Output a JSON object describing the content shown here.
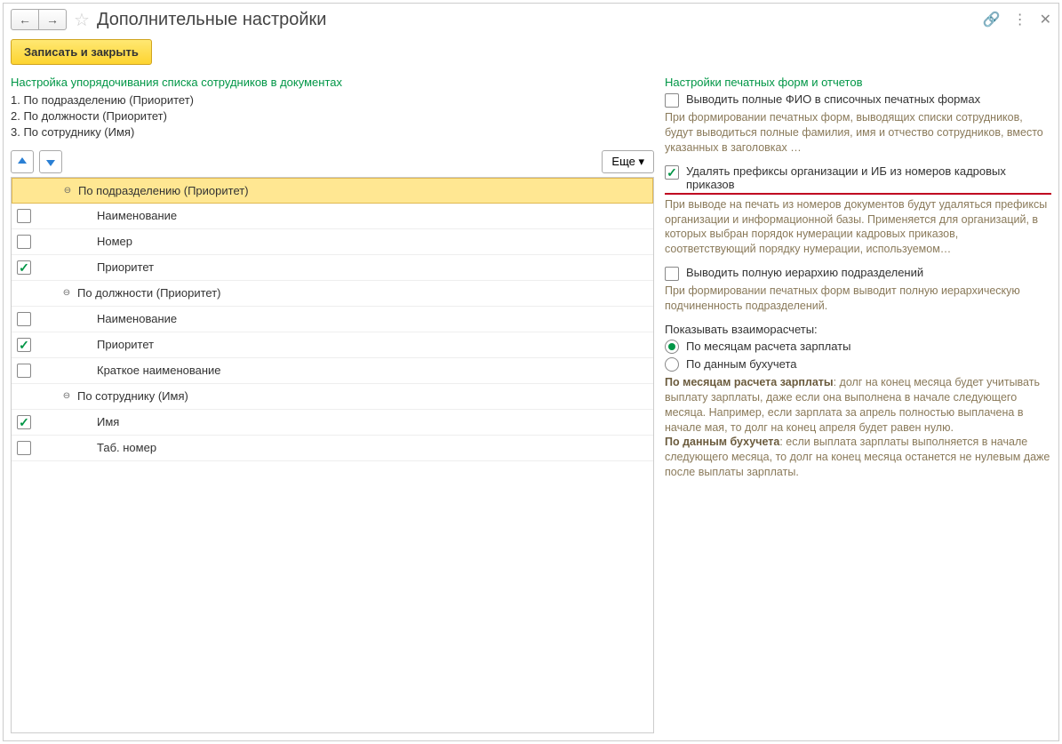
{
  "titlebar": {
    "title": "Дополнительные настройки"
  },
  "toolbar": {
    "save_label": "Записать и закрыть"
  },
  "left": {
    "header": "Настройка упорядочивания списка сотрудников в документах",
    "order": [
      "1. По подразделению (Приоритет)",
      "2. По должности (Приоритет)",
      "3. По сотруднику (Имя)"
    ],
    "more_label": "Еще",
    "tree": [
      {
        "type": "group",
        "label": "По подразделению (Приоритет)",
        "selected": true
      },
      {
        "type": "item",
        "label": "Наименование",
        "checked": false
      },
      {
        "type": "item",
        "label": "Номер",
        "checked": false
      },
      {
        "type": "item",
        "label": "Приоритет",
        "checked": true
      },
      {
        "type": "group",
        "label": "По должности (Приоритет)",
        "selected": false
      },
      {
        "type": "item",
        "label": "Наименование",
        "checked": false
      },
      {
        "type": "item",
        "label": "Приоритет",
        "checked": true
      },
      {
        "type": "item",
        "label": "Краткое наименование",
        "checked": false
      },
      {
        "type": "group",
        "label": "По сотруднику (Имя)",
        "selected": false
      },
      {
        "type": "item",
        "label": "Имя",
        "checked": true
      },
      {
        "type": "item",
        "label": "Таб. номер",
        "checked": false
      }
    ]
  },
  "right": {
    "header": "Настройки печатных форм и отчетов",
    "check1_label": "Выводить полные ФИО в списочных печатных формах",
    "check1_help": "При формировании печатных форм, выводящих списки сотрудников, будут выводиться полные фамилия, имя и отчество сотрудников, вместо указанных в заголовках …",
    "check2_label": "Удалять префиксы организации и ИБ из номеров кадровых приказов",
    "check2_help": "При выводе на печать из номеров документов будут удаляться префиксы организации и информационной базы. Применяется для организаций, в которых выбран порядок нумерации кадровых приказов, соответствующий порядку нумерации, используемом…",
    "check3_label": "Выводить полную иерархию подразделений",
    "check3_help": "При формировании печатных форм выводит полную иерархическую подчиненность подразделений.",
    "radio_header": "Показывать взаиморасчеты:",
    "radio1_label": "По месяцам расчета зарплаты",
    "radio2_label": "По данным бухучета",
    "rich1_bold": "По месяцам расчета зарплаты",
    "rich1_text": ": долг на конец месяца будет учитывать выплату зарплаты, даже если она выполнена в начале следующего месяца. Например, если зарплата за апрель полностью выплачена в начале мая, то долг на конец апреля будет равен нулю.",
    "rich2_bold": "По данным бухучета",
    "rich2_text": ": если выплата зарплаты выполняется в начале следующего месяца, то долг на конец месяца останется не нулевым даже после выплаты зарплаты."
  }
}
